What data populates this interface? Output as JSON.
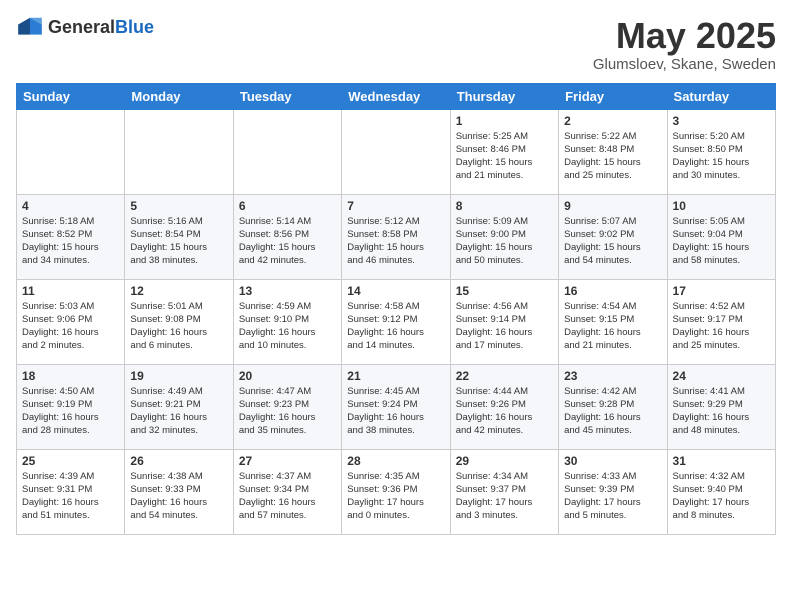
{
  "header": {
    "logo": {
      "general": "General",
      "blue": "Blue"
    },
    "title": "May 2025",
    "subtitle": "Glumsloev, Skane, Sweden"
  },
  "weekdays": [
    "Sunday",
    "Monday",
    "Tuesday",
    "Wednesday",
    "Thursday",
    "Friday",
    "Saturday"
  ],
  "weeks": [
    [
      {
        "day": "",
        "info": ""
      },
      {
        "day": "",
        "info": ""
      },
      {
        "day": "",
        "info": ""
      },
      {
        "day": "",
        "info": ""
      },
      {
        "day": "1",
        "info": "Sunrise: 5:25 AM\nSunset: 8:46 PM\nDaylight: 15 hours\nand 21 minutes."
      },
      {
        "day": "2",
        "info": "Sunrise: 5:22 AM\nSunset: 8:48 PM\nDaylight: 15 hours\nand 25 minutes."
      },
      {
        "day": "3",
        "info": "Sunrise: 5:20 AM\nSunset: 8:50 PM\nDaylight: 15 hours\nand 30 minutes."
      }
    ],
    [
      {
        "day": "4",
        "info": "Sunrise: 5:18 AM\nSunset: 8:52 PM\nDaylight: 15 hours\nand 34 minutes."
      },
      {
        "day": "5",
        "info": "Sunrise: 5:16 AM\nSunset: 8:54 PM\nDaylight: 15 hours\nand 38 minutes."
      },
      {
        "day": "6",
        "info": "Sunrise: 5:14 AM\nSunset: 8:56 PM\nDaylight: 15 hours\nand 42 minutes."
      },
      {
        "day": "7",
        "info": "Sunrise: 5:12 AM\nSunset: 8:58 PM\nDaylight: 15 hours\nand 46 minutes."
      },
      {
        "day": "8",
        "info": "Sunrise: 5:09 AM\nSunset: 9:00 PM\nDaylight: 15 hours\nand 50 minutes."
      },
      {
        "day": "9",
        "info": "Sunrise: 5:07 AM\nSunset: 9:02 PM\nDaylight: 15 hours\nand 54 minutes."
      },
      {
        "day": "10",
        "info": "Sunrise: 5:05 AM\nSunset: 9:04 PM\nDaylight: 15 hours\nand 58 minutes."
      }
    ],
    [
      {
        "day": "11",
        "info": "Sunrise: 5:03 AM\nSunset: 9:06 PM\nDaylight: 16 hours\nand 2 minutes."
      },
      {
        "day": "12",
        "info": "Sunrise: 5:01 AM\nSunset: 9:08 PM\nDaylight: 16 hours\nand 6 minutes."
      },
      {
        "day": "13",
        "info": "Sunrise: 4:59 AM\nSunset: 9:10 PM\nDaylight: 16 hours\nand 10 minutes."
      },
      {
        "day": "14",
        "info": "Sunrise: 4:58 AM\nSunset: 9:12 PM\nDaylight: 16 hours\nand 14 minutes."
      },
      {
        "day": "15",
        "info": "Sunrise: 4:56 AM\nSunset: 9:14 PM\nDaylight: 16 hours\nand 17 minutes."
      },
      {
        "day": "16",
        "info": "Sunrise: 4:54 AM\nSunset: 9:15 PM\nDaylight: 16 hours\nand 21 minutes."
      },
      {
        "day": "17",
        "info": "Sunrise: 4:52 AM\nSunset: 9:17 PM\nDaylight: 16 hours\nand 25 minutes."
      }
    ],
    [
      {
        "day": "18",
        "info": "Sunrise: 4:50 AM\nSunset: 9:19 PM\nDaylight: 16 hours\nand 28 minutes."
      },
      {
        "day": "19",
        "info": "Sunrise: 4:49 AM\nSunset: 9:21 PM\nDaylight: 16 hours\nand 32 minutes."
      },
      {
        "day": "20",
        "info": "Sunrise: 4:47 AM\nSunset: 9:23 PM\nDaylight: 16 hours\nand 35 minutes."
      },
      {
        "day": "21",
        "info": "Sunrise: 4:45 AM\nSunset: 9:24 PM\nDaylight: 16 hours\nand 38 minutes."
      },
      {
        "day": "22",
        "info": "Sunrise: 4:44 AM\nSunset: 9:26 PM\nDaylight: 16 hours\nand 42 minutes."
      },
      {
        "day": "23",
        "info": "Sunrise: 4:42 AM\nSunset: 9:28 PM\nDaylight: 16 hours\nand 45 minutes."
      },
      {
        "day": "24",
        "info": "Sunrise: 4:41 AM\nSunset: 9:29 PM\nDaylight: 16 hours\nand 48 minutes."
      }
    ],
    [
      {
        "day": "25",
        "info": "Sunrise: 4:39 AM\nSunset: 9:31 PM\nDaylight: 16 hours\nand 51 minutes."
      },
      {
        "day": "26",
        "info": "Sunrise: 4:38 AM\nSunset: 9:33 PM\nDaylight: 16 hours\nand 54 minutes."
      },
      {
        "day": "27",
        "info": "Sunrise: 4:37 AM\nSunset: 9:34 PM\nDaylight: 16 hours\nand 57 minutes."
      },
      {
        "day": "28",
        "info": "Sunrise: 4:35 AM\nSunset: 9:36 PM\nDaylight: 17 hours\nand 0 minutes."
      },
      {
        "day": "29",
        "info": "Sunrise: 4:34 AM\nSunset: 9:37 PM\nDaylight: 17 hours\nand 3 minutes."
      },
      {
        "day": "30",
        "info": "Sunrise: 4:33 AM\nSunset: 9:39 PM\nDaylight: 17 hours\nand 5 minutes."
      },
      {
        "day": "31",
        "info": "Sunrise: 4:32 AM\nSunset: 9:40 PM\nDaylight: 17 hours\nand 8 minutes."
      }
    ]
  ]
}
